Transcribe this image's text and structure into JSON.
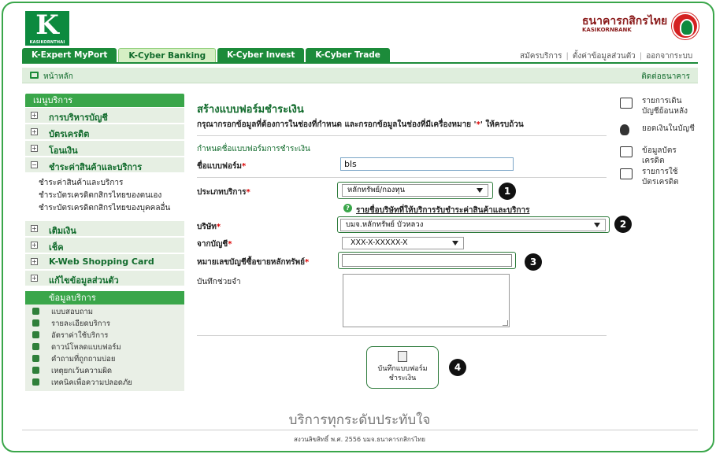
{
  "header": {
    "logo_brand": "KASIKORNTHAI",
    "bank_name_th": "ธนาคารกสิกรไทย",
    "bank_name_en": "KASIKORNBANK"
  },
  "tabs": [
    {
      "label": "K-Expert MyPort",
      "active": false
    },
    {
      "label": "K-Cyber Banking",
      "active": true
    },
    {
      "label": "K-Cyber Invest",
      "active": false
    },
    {
      "label": "K-Cyber Trade",
      "active": false
    }
  ],
  "toplinks": [
    "สมัครบริการ",
    "ตั้งค่าข้อมูลส่วนตัว",
    "ออกจากระบบ"
  ],
  "navbar": {
    "home": "หน้าหลัก",
    "contact": "ติดต่อธนาคาร"
  },
  "sidebar": {
    "menu_title": "เมนูบริการ",
    "items": [
      {
        "label": "การบริหารบัญชี",
        "toggle": "+"
      },
      {
        "label": "บัตรเครดิต",
        "toggle": "+"
      },
      {
        "label": "โอนเงิน",
        "toggle": "+"
      },
      {
        "label": "ชำระค่าสินค้าและบริการ",
        "toggle": "−"
      },
      {
        "label": "เติมเงิน",
        "toggle": "+"
      },
      {
        "label": "เช็ค",
        "toggle": "+"
      },
      {
        "label": "K-Web Shopping Card",
        "toggle": "+"
      },
      {
        "label": "แก้ไขข้อมูลส่วนตัว",
        "toggle": "+"
      }
    ],
    "sub_items": [
      "ชำระค่าสินค้าและบริการ",
      "ชำระบัตรเครดิตกสิกรไทยของตนเอง",
      "ชำระบัตรเครดิตกสิกรไทยของบุคคลอื่น"
    ],
    "info_title": "ข้อมูลบริการ",
    "info_items": [
      {
        "label": "แบบสอบถาม",
        "icon": "checkbox-icon"
      },
      {
        "label": "รายละเอียดบริการ",
        "icon": "star-icon"
      },
      {
        "label": "อัตราค่าใช้บริการ",
        "icon": "calculator-icon"
      },
      {
        "label": "ดาวน์โหลดแบบฟอร์ม",
        "icon": "download-icon"
      },
      {
        "label": "คำถามที่ถูกถามบ่อย",
        "icon": "question-icon"
      },
      {
        "label": "เหตุยกเว้นความผิด",
        "icon": "scale-icon"
      },
      {
        "label": "เทคนิคเพื่อความปลอดภัย",
        "icon": "lock-icon"
      }
    ]
  },
  "main": {
    "title": "สร้างแบบฟอร์มชำระเงิน",
    "instruction_pre": "กรุณากรอกข้อมูลที่ต้องการในช่องที่กำหนด และกรอกข้อมูลในช่องที่มีเครื่องหมาย '",
    "instruction_star": "*",
    "instruction_post": "' ให้ครบถ้วน",
    "section_title": "กำหนดชื่อแบบฟอร์มการชำระเงิน",
    "form_name_label": "ชื่อแบบฟอร์ม",
    "form_name_value": "bls",
    "service_type_label": "ประเภทบริการ",
    "service_type_value": "หลักทรัพย์/กองทุน",
    "company_list_link": "รายชื่อบริษัทที่ให้บริการรับชำระค่าสินค้าและบริการ",
    "company_label": "บริษัท",
    "company_value": "บมจ.หลักทรัพย์ บัวหลวง",
    "from_account_label": "จากบัญชี",
    "from_account_value": "XXX-X-XXXXX-X",
    "securities_account_label": "หมายเลขบัญชีซื้อขายหลักทรัพย์",
    "securities_account_value": "",
    "memo_label": "บันทึกช่วยจำ",
    "save_line1": "บันทึกแบบฟอร์ม",
    "save_line2": "ชำระเงิน",
    "star": "*",
    "badges": [
      "1",
      "2",
      "3",
      "4"
    ]
  },
  "quicklinks": [
    {
      "line1": "รายการเดิน",
      "line2": "บัญชีย้อนหลัง",
      "icon": "statement-icon"
    },
    {
      "line1": "ยอดเงินในบัญชี",
      "line2": "",
      "icon": "money-bag-icon"
    },
    {
      "line1": "ข้อมูลบัตรเครดิต",
      "line2": "",
      "icon": "credit-card-icon"
    },
    {
      "line1": "รายการใช้",
      "line2": "บัตรเครดิต",
      "icon": "card-list-icon"
    }
  ],
  "footer": {
    "slogan": "บริการทุกระดับประทับใจ",
    "copyright": "สงวนลิขสิทธิ์ พ.ศ. 2556 บมจ.ธนาคารกสิกรไทย"
  },
  "colors": {
    "brand_green": "#1c8b3a",
    "light_green": "#dfeedd",
    "required_red": "#dd0000",
    "bank_red": "#d42121"
  }
}
